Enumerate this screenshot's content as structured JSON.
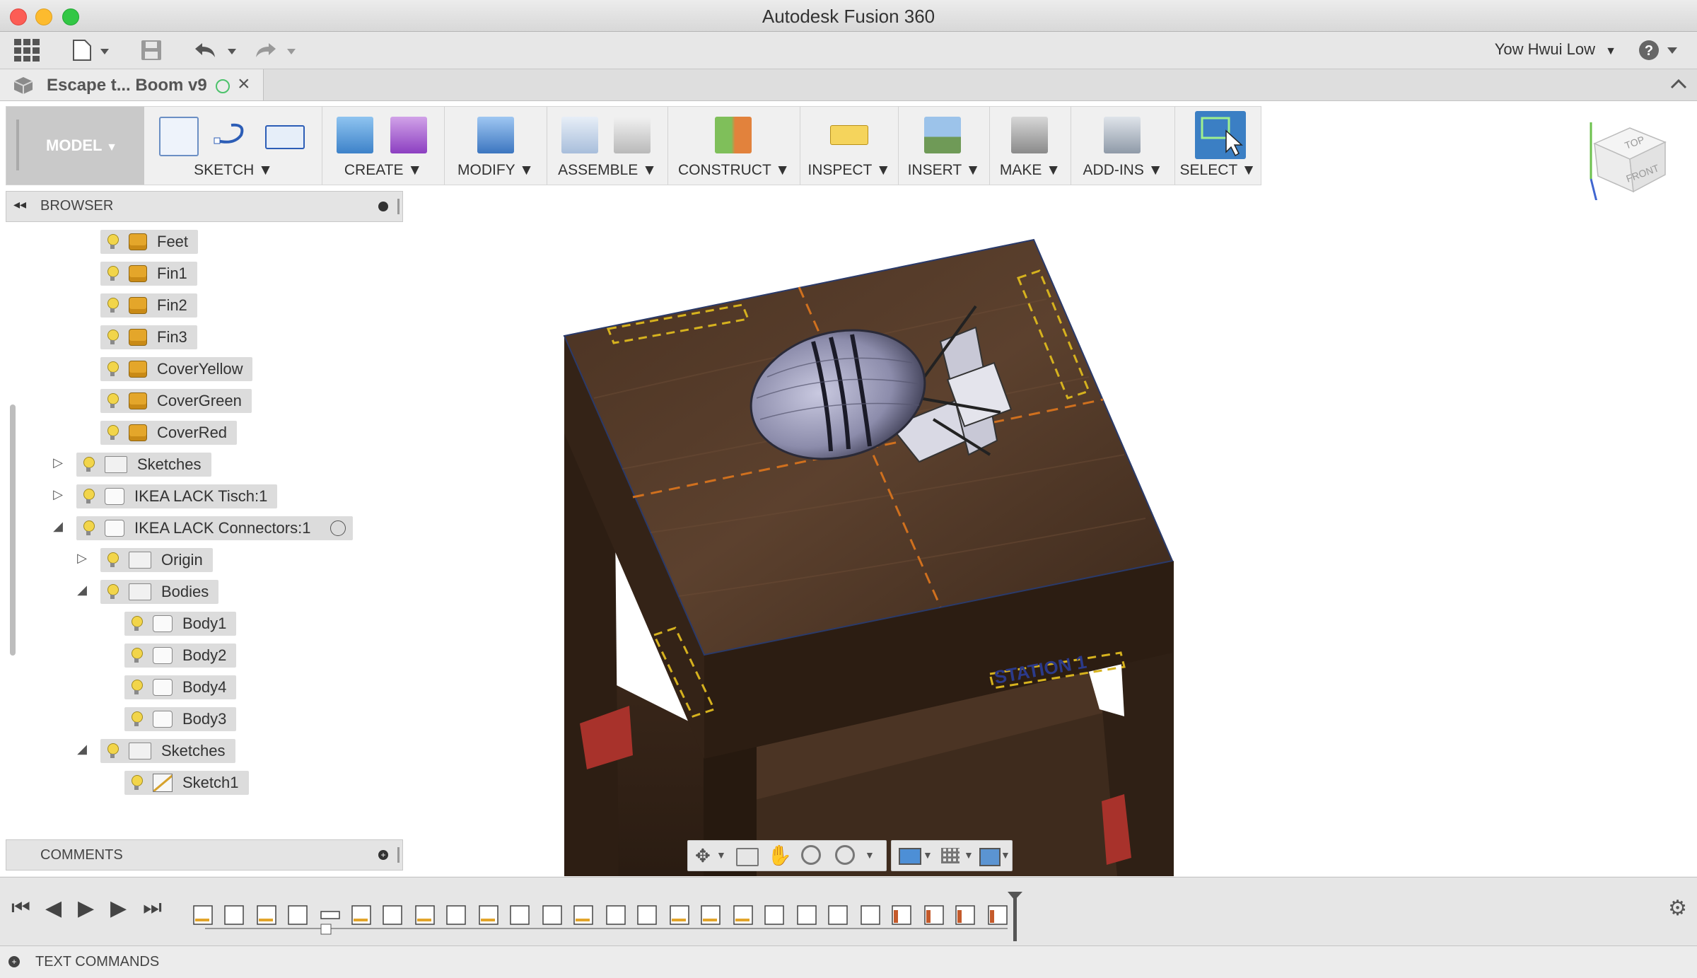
{
  "window": {
    "title": "Autodesk Fusion 360"
  },
  "quick_access": {
    "user_name": "Yow Hwui Low"
  },
  "document_tab": {
    "label": "Escape t... Boom v9"
  },
  "toolbar": {
    "workspace": "MODEL",
    "groups": [
      {
        "label": "SKETCH"
      },
      {
        "label": "CREATE"
      },
      {
        "label": "MODIFY"
      },
      {
        "label": "ASSEMBLE"
      },
      {
        "label": "CONSTRUCT"
      },
      {
        "label": "INSPECT"
      },
      {
        "label": "INSERT"
      },
      {
        "label": "MAKE"
      },
      {
        "label": "ADD-INS"
      },
      {
        "label": "SELECT"
      }
    ]
  },
  "browser": {
    "title": "BROWSER",
    "nodes": [
      {
        "label": "Feet",
        "icon": "component-icon"
      },
      {
        "label": "Fin1",
        "icon": "component-icon"
      },
      {
        "label": "Fin2",
        "icon": "component-icon"
      },
      {
        "label": "Fin3",
        "icon": "component-icon"
      },
      {
        "label": "CoverYellow",
        "icon": "component-icon"
      },
      {
        "label": "CoverGreen",
        "icon": "component-icon"
      },
      {
        "label": "CoverRed",
        "icon": "component-icon"
      },
      {
        "label": "Sketches",
        "icon": "folder-icon",
        "state": "collapsed"
      },
      {
        "label": "IKEA LACK Tisch:1",
        "icon": "component-icon",
        "state": "collapsed"
      },
      {
        "label": "IKEA LACK Connectors:1",
        "icon": "component-icon",
        "state": "expanded"
      },
      {
        "label": "Origin",
        "icon": "folder-icon",
        "state": "collapsed"
      },
      {
        "label": "Bodies",
        "icon": "folder-icon",
        "state": "expanded"
      },
      {
        "label": "Body1",
        "icon": "body-icon"
      },
      {
        "label": "Body2",
        "icon": "body-icon"
      },
      {
        "label": "Body4",
        "icon": "body-icon"
      },
      {
        "label": "Body3",
        "icon": "body-icon"
      },
      {
        "label": "Sketches",
        "icon": "folder-icon",
        "state": "expanded"
      },
      {
        "label": "Sketch1",
        "icon": "sketch-icon"
      }
    ]
  },
  "comments": {
    "title": "COMMENTS"
  },
  "viewcube": {
    "top": "TOP",
    "front": "FRONT",
    "z": "Z"
  },
  "table_labels": {
    "station": "STATION 1"
  },
  "text_commands": {
    "title": "TEXT COMMANDS"
  },
  "colors": {
    "select_accent": "#3b7fc4",
    "wood_dark": "#3a271a",
    "wood_light": "#5e4330",
    "bracket": "#a8322b"
  }
}
